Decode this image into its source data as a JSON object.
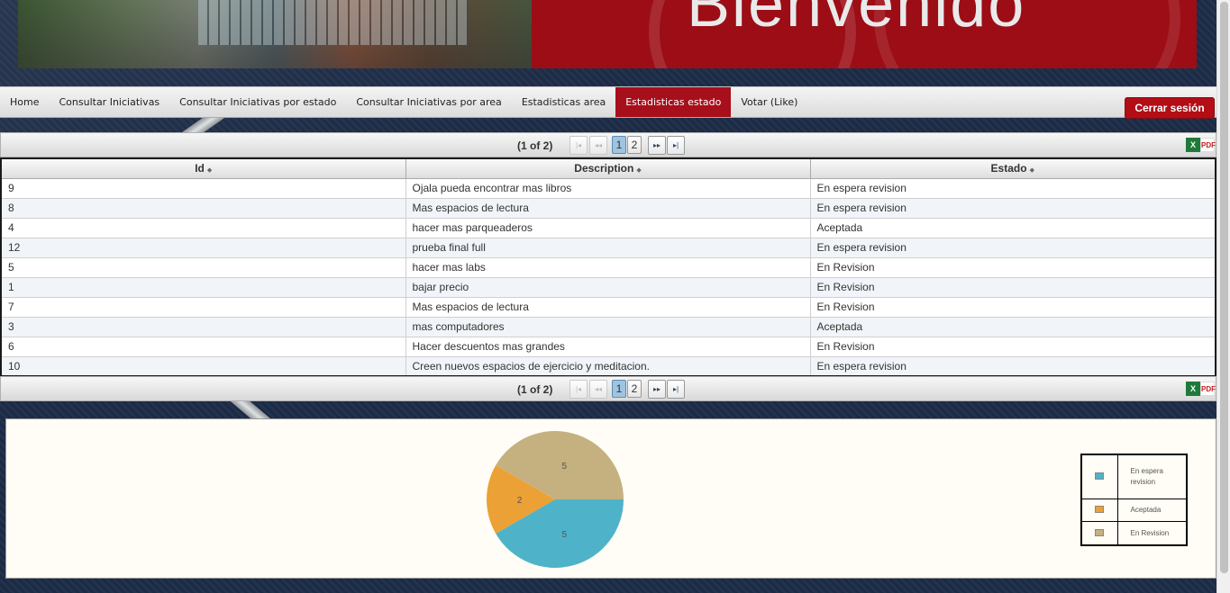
{
  "banner": {
    "welcome": "Bienvenido"
  },
  "nav": {
    "items": [
      {
        "label": "Home"
      },
      {
        "label": "Consultar Iniciativas"
      },
      {
        "label": "Consultar Iniciativas por estado"
      },
      {
        "label": "Consultar Iniciativas por area"
      },
      {
        "label": "Estadisticas area"
      },
      {
        "label": "Estadisticas estado"
      },
      {
        "label": "Votar (Like)"
      }
    ],
    "active": "Estadisticas estado",
    "logout": "Cerrar sesión"
  },
  "paginator": {
    "current": "(1 of 2)",
    "pages": [
      "1",
      "2"
    ],
    "active_page": "1",
    "first_icon": "first-page-icon",
    "prev_icon": "prev-page-icon",
    "next_icon": "next-page-icon",
    "last_icon": "last-page-icon",
    "excel_icon": "excel-icon",
    "pdf_icon": "pdf-icon"
  },
  "table": {
    "columns": [
      "Id",
      "Description",
      "Estado"
    ],
    "rows": [
      [
        "9",
        "Ojala pueda encontrar mas libros",
        "En espera revision"
      ],
      [
        "8",
        "Mas espacios de lectura",
        "En espera revision"
      ],
      [
        "4",
        "hacer mas parqueaderos",
        "Aceptada"
      ],
      [
        "12",
        "prueba final full",
        "En espera revision"
      ],
      [
        "5",
        "hacer mas labs",
        "En Revision"
      ],
      [
        "1",
        "bajar precio",
        "En Revision"
      ],
      [
        "7",
        "Mas espacios de lectura",
        "En Revision"
      ],
      [
        "3",
        "mas computadores",
        "Aceptada"
      ],
      [
        "6",
        "Hacer descuentos mas grandes",
        "En Revision"
      ],
      [
        "10",
        "Creen nuevos espacios de ejercicio y meditacion.",
        "En espera revision"
      ]
    ]
  },
  "colors": {
    "accent": "#a70f1a",
    "espera": "#4eb3c9",
    "aceptada": "#eba135",
    "revision": "#c5b17f"
  },
  "chart_data": {
    "type": "pie",
    "categories": [
      "En espera revision",
      "Aceptada",
      "En Revision"
    ],
    "values": [
      5,
      2,
      5
    ],
    "colors": [
      "#4eb3c9",
      "#eba135",
      "#c5b17f"
    ],
    "labels": [
      "5",
      "2",
      "5"
    ],
    "legend": "right"
  }
}
